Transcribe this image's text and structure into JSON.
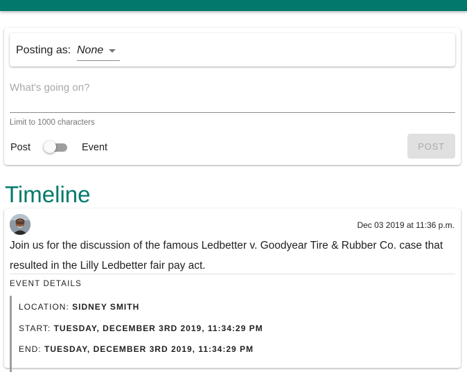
{
  "composer": {
    "posting_as_label": "Posting as:",
    "posting_as_value": "None",
    "textarea_placeholder": "What's going on?",
    "limit_hint": "Limit to 1000 characters",
    "toggle_left_label": "Post",
    "toggle_right_label": "Event",
    "post_button_label": "POST"
  },
  "timeline": {
    "title": "Timeline",
    "posts": [
      {
        "date": "Dec 03 2019 at 11:36 p.m.",
        "body": "Join us for the discussion of the famous Ledbetter v. Goodyear Tire & Rubber Co. case that resulted in the Lilly Ledbetter fair pay act.",
        "event_details_label": "EVENT DETAILS",
        "location_label": "LOCATION:",
        "location_value": "SIDNEY SMITH",
        "start_label": "START:",
        "start_value": "TUESDAY, DECEMBER 3RD 2019, 11:34:29 PM",
        "end_label": "END:",
        "end_value": "TUESDAY, DECEMBER 3RD 2019, 11:34:29 PM"
      }
    ]
  },
  "colors": {
    "app_bar": "#00796b",
    "accent": "#00796b",
    "disabled_button": "#e0e0e0"
  }
}
